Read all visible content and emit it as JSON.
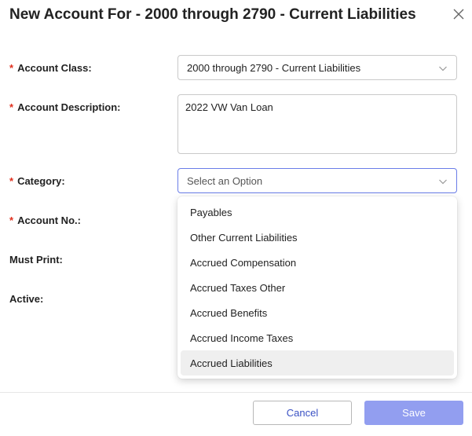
{
  "dialog": {
    "title": "New Account For - 2000 through 2790 - Current Liabilities"
  },
  "form": {
    "required_marker": "*",
    "account_class": {
      "label": "Account Class:",
      "value": "2000 through 2790 - Current Liabilities",
      "required": true
    },
    "account_description": {
      "label": "Account Description:",
      "value": "2022 VW Van Loan",
      "required": true
    },
    "category": {
      "label": "Category:",
      "placeholder": "Select an Option",
      "required": true,
      "options": [
        "Payables",
        "Other Current Liabilities",
        "Accrued Compensation",
        "Accrued Taxes Other",
        "Accrued Benefits",
        "Accrued Income Taxes",
        "Accrued Liabilities"
      ],
      "highlighted_option": "Accrued Liabilities"
    },
    "account_no": {
      "label": "Account No.:",
      "required": true
    },
    "must_print": {
      "label": "Must Print:"
    },
    "active": {
      "label": "Active:"
    }
  },
  "footer": {
    "cancel_label": "Cancel",
    "save_label": "Save"
  },
  "colors": {
    "required": "#e0301e",
    "focus_border": "#6a7de8",
    "primary_disabled": "#929ef0",
    "link_text": "#3b52c4"
  },
  "icons": {
    "close": "close-icon",
    "dropdown": "chevron-down-icon"
  }
}
